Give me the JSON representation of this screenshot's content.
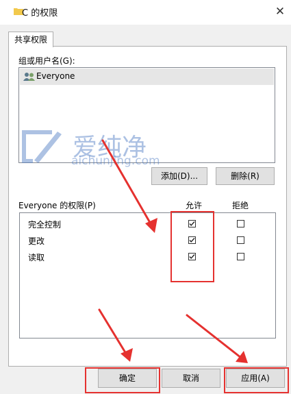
{
  "window": {
    "title": "C 的权限",
    "close_symbol": "✕"
  },
  "tabs": [
    {
      "label": "共享权限"
    }
  ],
  "group": {
    "label": "组或用户名(G):",
    "items": [
      {
        "name": "Everyone"
      }
    ]
  },
  "buttons": {
    "add": "添加(D)...",
    "remove": "删除(R)",
    "ok": "确定",
    "cancel": "取消",
    "apply": "应用(A)"
  },
  "permissions": {
    "label": "Everyone 的权限(P)",
    "allow_header": "允许",
    "deny_header": "拒绝",
    "rows": [
      {
        "name": "完全控制",
        "allow": true,
        "deny": false
      },
      {
        "name": "更改",
        "allow": true,
        "deny": false
      },
      {
        "name": "读取",
        "allow": true,
        "deny": false
      }
    ]
  },
  "watermark": {
    "text": "爱纯净",
    "url": "aichunjing.com"
  },
  "colors": {
    "annotation_red": "#e5312f",
    "selection": "#e6e6e6"
  }
}
